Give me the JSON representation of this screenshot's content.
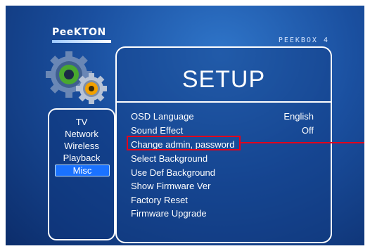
{
  "brand": "PeeKTON",
  "model": "PEEKBOX 4",
  "icons": {
    "gears": "settings-gears-icon"
  },
  "sidebar": {
    "items": [
      {
        "label": "TV"
      },
      {
        "label": "Network"
      },
      {
        "label": "Wireless"
      },
      {
        "label": "Playback"
      },
      {
        "label": "Misc",
        "active": true
      }
    ]
  },
  "setup": {
    "title": "SETUP",
    "options": [
      {
        "label": "OSD Language",
        "value": "English"
      },
      {
        "label": "Sound Effect",
        "value": "Off"
      },
      {
        "label": "Change admin, password",
        "value": ""
      },
      {
        "label": "Select Background",
        "value": ""
      },
      {
        "label": "Use Def Background",
        "value": ""
      },
      {
        "label": "Show Firmware Ver",
        "value": ""
      },
      {
        "label": "Factory Reset",
        "value": ""
      },
      {
        "label": "Firmware Upgrade",
        "value": ""
      }
    ]
  },
  "colors": {
    "background": "#1a4f9f",
    "active_tab": "#1a72ff",
    "highlight": "#e3001b"
  }
}
